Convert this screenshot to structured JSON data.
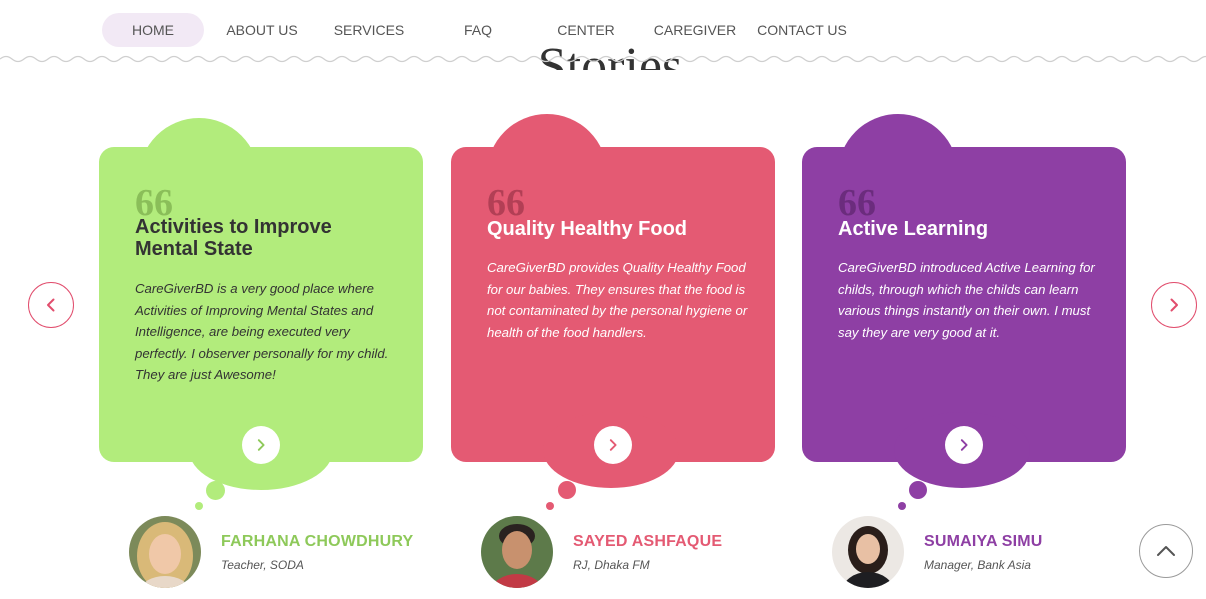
{
  "nav": {
    "items": [
      {
        "label": "HOME",
        "active": true
      },
      {
        "label": "ABOUT US",
        "active": false
      },
      {
        "label": "SERVICES",
        "active": false
      },
      {
        "label": "FAQ",
        "active": false
      },
      {
        "label": "CENTER",
        "active": false
      },
      {
        "label": "CAREGIVER",
        "active": false
      },
      {
        "label": "CONTACT US",
        "active": false
      }
    ]
  },
  "section": {
    "title": "Stories"
  },
  "cards": [
    {
      "title": "Activities to Improve Mental State",
      "text": "CareGiverBD is a very good place where Activities of Improving Mental States and Intelligence, are being executed very perfectly. I observer personally for my child. They are just Awesome!",
      "color": "#b2ec7c",
      "text_color": "#333333",
      "accent": "#8ec95a",
      "person": {
        "name": "FARHANA CHOWDHURY",
        "role": "Teacher, SODA"
      }
    },
    {
      "title": "Quality Healthy Food",
      "text": "CareGiverBD provides Quality Healthy Food for our babies. They ensures that the food is not contaminated by the personal hygiene or health of the food handlers.",
      "color": "#e45a73",
      "text_color": "#ffffff",
      "accent": "#e45a73",
      "person": {
        "name": "SAYED ASHFAQUE",
        "role": "RJ, Dhaka FM"
      }
    },
    {
      "title": "Active Learning",
      "text": "CareGiverBD introduced Active Learning for childs, through which the childs can learn various things instantly on their own. I must say they are very good at it.",
      "color": "#8e3fa4",
      "text_color": "#ffffff",
      "accent": "#8e3fa4",
      "person": {
        "name": "SUMAIYA SIMU",
        "role": "Manager, Bank Asia"
      }
    }
  ],
  "quote_glyph": "66",
  "icons": {
    "prev": "chevron-left-icon",
    "next": "chevron-right-icon",
    "card_more": "chevron-right-icon",
    "back_to_top": "chevron-up-icon"
  },
  "colors": {
    "nav_active_bg": "#f2e9f5",
    "arrow_border": "#e14d6d",
    "wave": "#cfcfcf"
  }
}
